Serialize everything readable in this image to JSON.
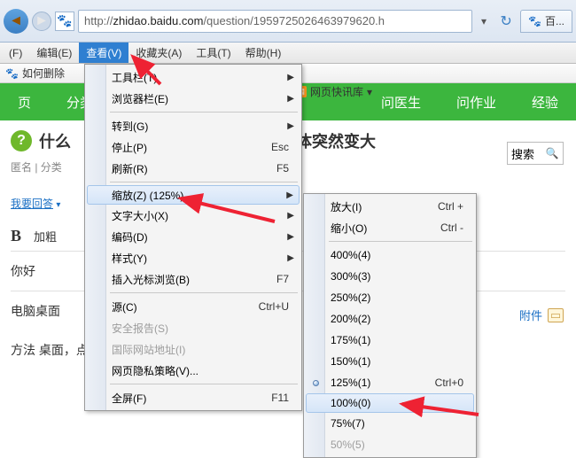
{
  "titlebar": {
    "url_prefix": "http://",
    "url_host": "zhidao.baidu.com",
    "url_path": "/question/1959725026463979620.h",
    "tab_label": "百..."
  },
  "menubar": {
    "file": "(F)",
    "edit": "编辑(E)",
    "view": "查看(V)",
    "favorites": "收藏夹(A)",
    "tools": "工具(T)",
    "help": "帮助(H)"
  },
  "fav_bar": {
    "label": "如何删除"
  },
  "green_nav": {
    "item1": "页",
    "item2": "分类",
    "item3": "问医生",
    "item4": "问作业",
    "item5": "经验"
  },
  "quicklib": "网页快讯库",
  "page": {
    "question_prefix": "什么",
    "question_suffix": "体突然变大",
    "breadcrumb": "匿名 | 分类",
    "answer_link": "我要回答",
    "bold_label": "加粗",
    "attach_label": "附件",
    "line1": "你好",
    "line2": "电脑桌面",
    "line3": "方法   桌面，点击右键可以看到\"图形属性\"过"
  },
  "search": {
    "placeholder": "搜索"
  },
  "menu1": {
    "toolbar": "工具栏(T)",
    "explorer_bar": "浏览器栏(E)",
    "goto": "转到(G)",
    "stop": "停止(P)",
    "stop_key": "Esc",
    "refresh": "刷新(R)",
    "refresh_key": "F5",
    "zoom": "缩放(Z) (125%)",
    "textsize": "文字大小(X)",
    "encoding": "编码(D)",
    "style": "样式(Y)",
    "caret": "插入光标浏览(B)",
    "caret_key": "F7",
    "source": "源(C)",
    "source_key": "Ctrl+U",
    "security": "安全报告(S)",
    "intl": "国际网站地址(I)",
    "privacy": "网页隐私策略(V)...",
    "fullscreen": "全屏(F)",
    "fullscreen_key": "F11"
  },
  "menu2": {
    "zoom_in": "放大(I)",
    "zoom_in_key": "Ctrl +",
    "zoom_out": "缩小(O)",
    "zoom_out_key": "Ctrl -",
    "z400": "400%(4)",
    "z300": "300%(3)",
    "z250": "250%(2)",
    "z200": "200%(2)",
    "z175": "175%(1)",
    "z150": "150%(1)",
    "z125": "125%(1)",
    "z125_key": "Ctrl+0",
    "z100": "100%(0)",
    "z75": "75%(7)",
    "z50": "50%(5)"
  }
}
